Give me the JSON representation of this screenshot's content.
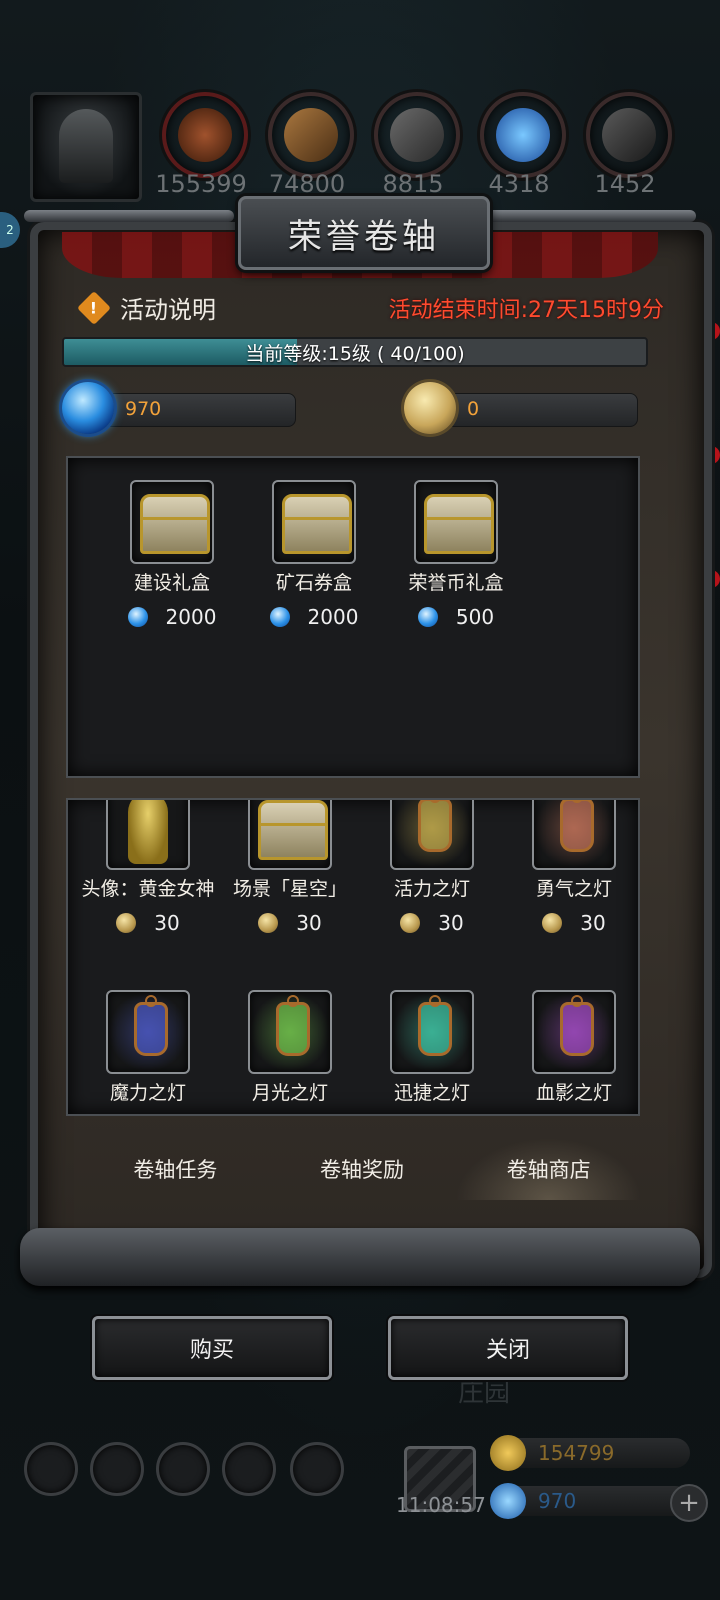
{
  "resources": [
    {
      "icon": "meat-resource-icon",
      "count": "155399",
      "color": "#8a3a1a"
    },
    {
      "icon": "wood-resource-icon",
      "count": "74800",
      "color": "#8a5a2a"
    },
    {
      "icon": "iron-resource-icon",
      "count": "8815",
      "color": "#5a5a5a"
    },
    {
      "icon": "crystal-resource-icon",
      "count": "4318",
      "color": "#2a7ad0"
    },
    {
      "icon": "steel-resource-icon",
      "count": "1452",
      "color": "#4a4a4a"
    }
  ],
  "panel": {
    "title": "荣誉卷轴",
    "info_label": "活动说明",
    "end_time": "活动结束时间:27天15时9分",
    "progress_text": "当前等级:15级 ( 40/100)",
    "progress_fraction": 0.4,
    "gem_balance": "970",
    "coin_balance": "0"
  },
  "gem_shop": [
    {
      "name": "建设礼盒",
      "price": "2000",
      "icon": "chest-icon"
    },
    {
      "name": "矿石券盒",
      "price": "2000",
      "icon": "chest-icon"
    },
    {
      "name": "荣誉币礼盒",
      "price": "500",
      "icon": "chest-icon"
    }
  ],
  "coin_shop_row1": [
    {
      "name": "头像：黄金女神",
      "price": "30",
      "icon": "golden-goddess-icon"
    },
    {
      "name": "场景「星空」",
      "price": "30",
      "icon": "chest-icon"
    },
    {
      "name": "活力之灯",
      "price": "30",
      "icon": "lamp-icon",
      "glow": "#f2d35a"
    },
    {
      "name": "勇气之灯",
      "price": "30",
      "icon": "lamp-icon",
      "glow": "#f08a6a"
    }
  ],
  "coin_shop_row2": [
    {
      "name": "魔力之灯",
      "icon": "lamp-icon",
      "glow": "#5a6af2"
    },
    {
      "name": "月光之灯",
      "icon": "lamp-icon",
      "glow": "#8af25a"
    },
    {
      "name": "迅捷之灯",
      "icon": "lamp-icon",
      "glow": "#4af2c8"
    },
    {
      "name": "血影之灯",
      "icon": "lamp-icon",
      "glow": "#c85af2"
    }
  ],
  "tabs": [
    "卷轴任务",
    "卷轴奖励",
    "卷轴商店"
  ],
  "active_tab": 2,
  "buttons": {
    "buy": "购买",
    "close": "关闭"
  },
  "bottom": {
    "clock": "11:08:57",
    "gold": "154799",
    "gems": "970",
    "faded_label": "庄园"
  }
}
